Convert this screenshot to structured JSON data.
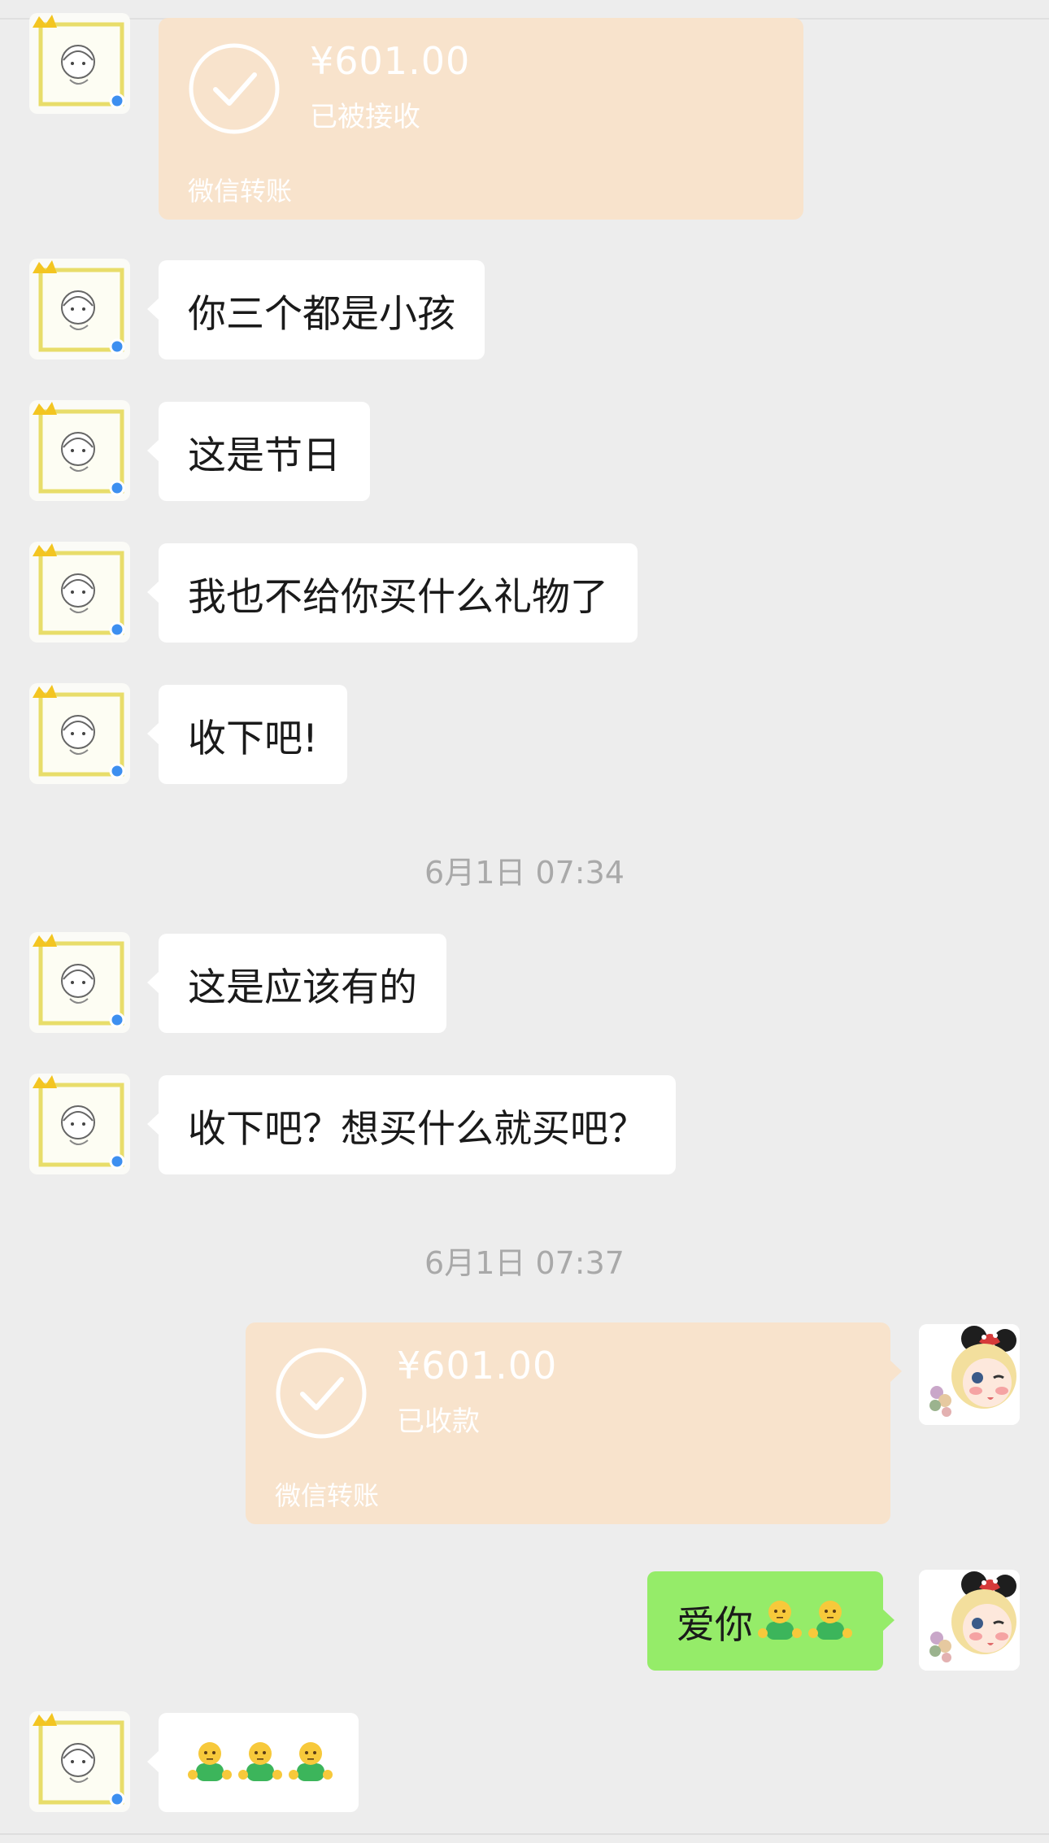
{
  "transfers": [
    {
      "amount": "¥601.00",
      "status": "已被接收",
      "footer": "微信转账"
    },
    {
      "amount": "¥601.00",
      "status": "已收款",
      "footer": "微信转账"
    }
  ],
  "messages": [
    {
      "text": "你三个都是小孩"
    },
    {
      "text": "这是节日"
    },
    {
      "text": "我也不给你买什么礼物了"
    },
    {
      "text": "收下吧!"
    },
    {
      "text": "这是应该有的"
    },
    {
      "text": "收下吧？想买什么就买吧？"
    },
    {
      "text": "爱你",
      "emoji": "person-emoji",
      "emoji_count": 2
    },
    {
      "text": "",
      "emoji": "person-emoji",
      "emoji_count": 3
    }
  ],
  "timestamps": [
    "6月1日 07:34",
    "6月1日 07:37"
  ],
  "colors": {
    "background": "#ededed",
    "bubble_incoming": "#ffffff",
    "bubble_outgoing": "#95ec69",
    "transfer_card": "#f8e3cc",
    "timestamp_text": "#a9a9a9"
  },
  "icons": {
    "contact_avatar": "crowned-cartoon-avatar",
    "self_avatar": "anime-girl-avatar",
    "transfer_icon": "check-circle-icon"
  }
}
